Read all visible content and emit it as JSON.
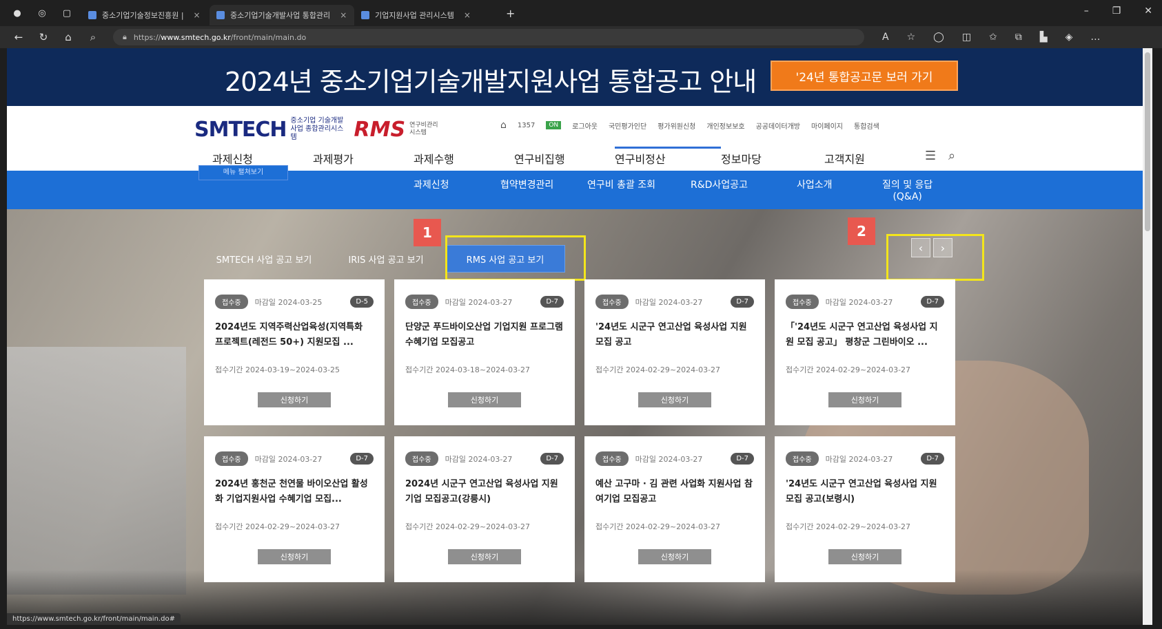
{
  "browser": {
    "tabs": [
      {
        "label": "중소기업기술정보진흥원 |",
        "active": false
      },
      {
        "label": "중소기업기술개발사업 통합관리",
        "active": true
      },
      {
        "label": "기업지원사업 관리시스템",
        "active": false
      }
    ],
    "url_prefix": "https://",
    "url_host": "www.smtech.go.kr",
    "url_path": "/front/main/main.do",
    "status_url": "https://www.smtech.go.kr/front/main/main.do#"
  },
  "banner": {
    "title": "2024년 중소기업기술개발지원사업 통합공고 안내",
    "button": "'24년 통합공고문 보러 가기"
  },
  "header": {
    "logo_smtech": "SMTECH",
    "logo_smtech_sub": "중소기업 기술개발사업 종합관리시스템",
    "logo_rms": "RMS",
    "logo_rms_sub": "연구비관리시스템",
    "util": [
      "1357",
      "로그아웃",
      "국민평가인단",
      "평가위원신청",
      "개인정보보호",
      "공공데이터개방",
      "마이페이지",
      "통합검색"
    ],
    "util_badge": "ON",
    "gnb": [
      "과제신청",
      "과제평가",
      "과제수행",
      "연구비집행",
      "연구비정산",
      "정보마당",
      "고객지원"
    ],
    "gnb_active": 4
  },
  "subnav": {
    "ghost": "메뉴 펼쳐보기",
    "items": [
      "과제신청",
      "협약변경관리",
      "연구비 총괄 조회",
      "R&D사업공고",
      "사업소개",
      "질의 및 응답",
      "(Q&A)"
    ]
  },
  "hero": {
    "filters": [
      "SMTECH 사업 공고 보기",
      "IRIS 사업 공고 보기",
      "RMS 사업 공고 보기"
    ],
    "active_filter": 2,
    "markers": [
      "1",
      "2"
    ],
    "pager": {
      "prev": "‹",
      "next": "›"
    },
    "cards": [
      {
        "tag": "접수중",
        "deadline": "마감일 2024-03-25",
        "status": "D-5",
        "title": "2024년도 지역주력산업육성(지역특화 프로젝트(레전드 50+) 지원모집 ...",
        "period": "접수기간 2024-03-19~2024-03-25",
        "button": "신청하기"
      },
      {
        "tag": "접수중",
        "deadline": "마감일 2024-03-27",
        "status": "D-7",
        "title": "단양군 푸드바이오산업 기업지원 프로그램 수혜기업 모집공고",
        "period": "접수기간 2024-03-18~2024-03-27",
        "button": "신청하기"
      },
      {
        "tag": "접수중",
        "deadline": "마감일 2024-03-27",
        "status": "D-7",
        "title": "'24년도 시군구 연고산업 육성사업 지원 모집 공고",
        "period": "접수기간 2024-02-29~2024-03-27",
        "button": "신청하기"
      },
      {
        "tag": "접수중",
        "deadline": "마감일 2024-03-27",
        "status": "D-7",
        "title": "「'24년도 시군구 연고산업 육성사업 지원 모집 공고」 평창군 그린바이오 ...",
        "period": "접수기간 2024-02-29~2024-03-27",
        "button": "신청하기"
      },
      {
        "tag": "접수중",
        "deadline": "마감일 2024-03-27",
        "status": "D-7",
        "title": "2024년 홍천군 천연물 바이오산업 활성화 기업지원사업 수혜기업 모집...",
        "period": "접수기간 2024-02-29~2024-03-27",
        "button": "신청하기"
      },
      {
        "tag": "접수중",
        "deadline": "마감일 2024-03-27",
        "status": "D-7",
        "title": "2024년 시군구 연고산업 육성사업 지원 기업 모집공고(강릉시)",
        "period": "접수기간 2024-02-29~2024-03-27",
        "button": "신청하기"
      },
      {
        "tag": "접수중",
        "deadline": "마감일 2024-03-27",
        "status": "D-7",
        "title": "예산 고구마 · 김 관련 사업화 지원사업 참여기업 모집공고",
        "period": "접수기간 2024-02-29~2024-03-27",
        "button": "신청하기"
      },
      {
        "tag": "접수중",
        "deadline": "마감일 2024-03-27",
        "status": "D-7",
        "title": "'24년도 시군구 연고산업 육성사업 지원 모집 공고(보령시)",
        "period": "접수기간 2024-02-29~2024-03-27",
        "button": "신청하기"
      }
    ]
  }
}
